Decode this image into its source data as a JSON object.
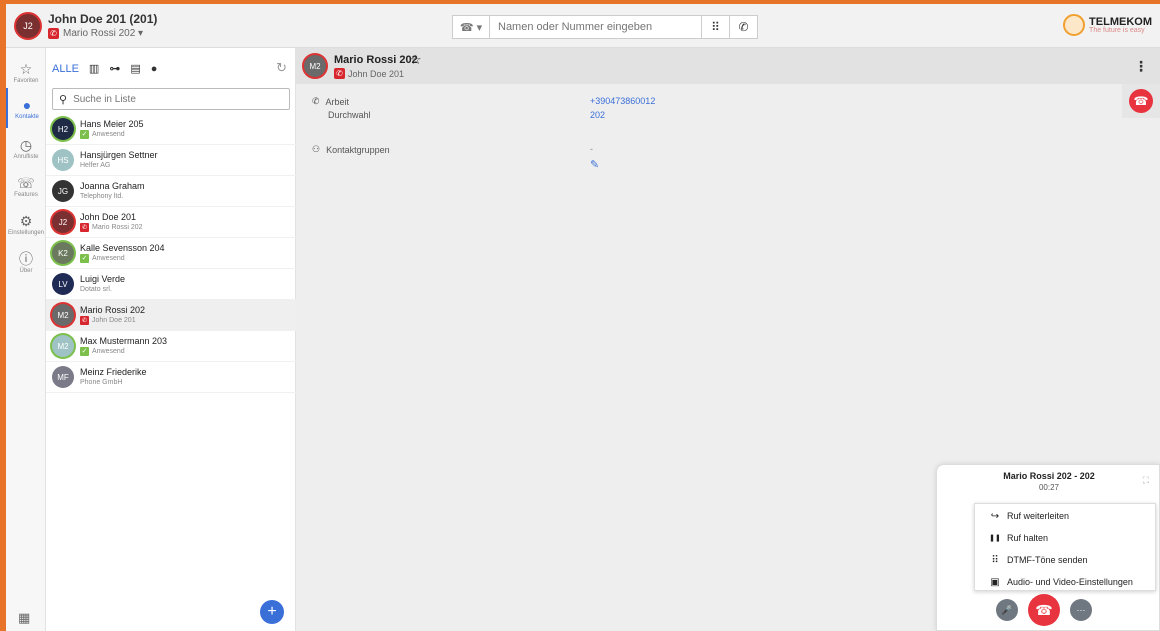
{
  "header": {
    "user_initials": "J2",
    "user_name": "John Doe 201 (201)",
    "user_call": "Mario Rossi 202 ▾",
    "dial_type_icon": "☎ ▾",
    "dial_placeholder": "Namen oder Nummer eingeben",
    "keypad_icon": "⠿",
    "call_icon": "✆",
    "logo_text": "TELMEKOM",
    "logo_tagline": "The future is easy"
  },
  "nav": [
    {
      "icon": "☆",
      "label": "Favoriten"
    },
    {
      "icon": "👤",
      "label": "Kontakte"
    },
    {
      "icon": "◷",
      "label": "Anrufliste"
    },
    {
      "icon": "☏",
      "label": "Features"
    },
    {
      "icon": "⚙",
      "label": "Einstellungen"
    },
    {
      "icon": "ⓘ",
      "label": "Über"
    }
  ],
  "list": {
    "filter_all": "ALLE",
    "search_placeholder": "Suche in Liste",
    "contacts": [
      {
        "initials": "H2",
        "name": "Hans Meier 205",
        "sub": "Anwesend",
        "color": "#1f2a44",
        "ring": "#7cc04b",
        "status": "green"
      },
      {
        "initials": "HS",
        "name": "Hansjürgen Settner",
        "sub": "Helfer AG",
        "color": "#9fc3c4",
        "ring": "",
        "status": "none"
      },
      {
        "initials": "JG",
        "name": "Joanna Graham",
        "sub": "Telephony ltd.",
        "color": "#333333",
        "ring": "",
        "status": "none"
      },
      {
        "initials": "J2",
        "name": "John Doe 201",
        "sub": "Mario Rossi 202",
        "color": "#7a3030",
        "ring": "#d33",
        "status": "red"
      },
      {
        "initials": "K2",
        "name": "Kalle Sevensson 204",
        "sub": "Anwesend",
        "color": "#6b7a5f",
        "ring": "#7cc04b",
        "status": "green"
      },
      {
        "initials": "LV",
        "name": "Luigi Verde",
        "sub": "Dotato srl.",
        "color": "#1f2a55",
        "ring": "",
        "status": "none"
      },
      {
        "initials": "M2",
        "name": "Mario Rossi 202",
        "sub": "John Doe 201",
        "color": "#6a6a6a",
        "ring": "#d33",
        "status": "red"
      },
      {
        "initials": "M2",
        "name": "Max Mustermann 203",
        "sub": "Anwesend",
        "color": "#9fc3c4",
        "ring": "#7cc04b",
        "status": "green"
      },
      {
        "initials": "MF",
        "name": "Meinz Friederike",
        "sub": "Phone GmbH",
        "color": "#7a7a88",
        "ring": "",
        "status": "none"
      }
    ]
  },
  "detail": {
    "initials": "M2",
    "name": "Mario Rossi 202",
    "sub": "John Doe 201",
    "work_label": "Arbeit",
    "work_value": "+390473860012",
    "ext_label": "Durchwahl",
    "ext_value": "202",
    "groups_label": "Kontaktgruppen",
    "groups_value": "-"
  },
  "call": {
    "title": "Mario Rossi 202 - 202",
    "time": "00:27",
    "menu": [
      {
        "icon": "↪",
        "label": "Ruf weiterleiten"
      },
      {
        "icon": "❚❚",
        "label": "Ruf halten"
      },
      {
        "icon": "⠿",
        "label": "DTMF-Töne senden"
      },
      {
        "icon": "▣",
        "label": "Audio- und Video-Einstellungen"
      }
    ]
  }
}
